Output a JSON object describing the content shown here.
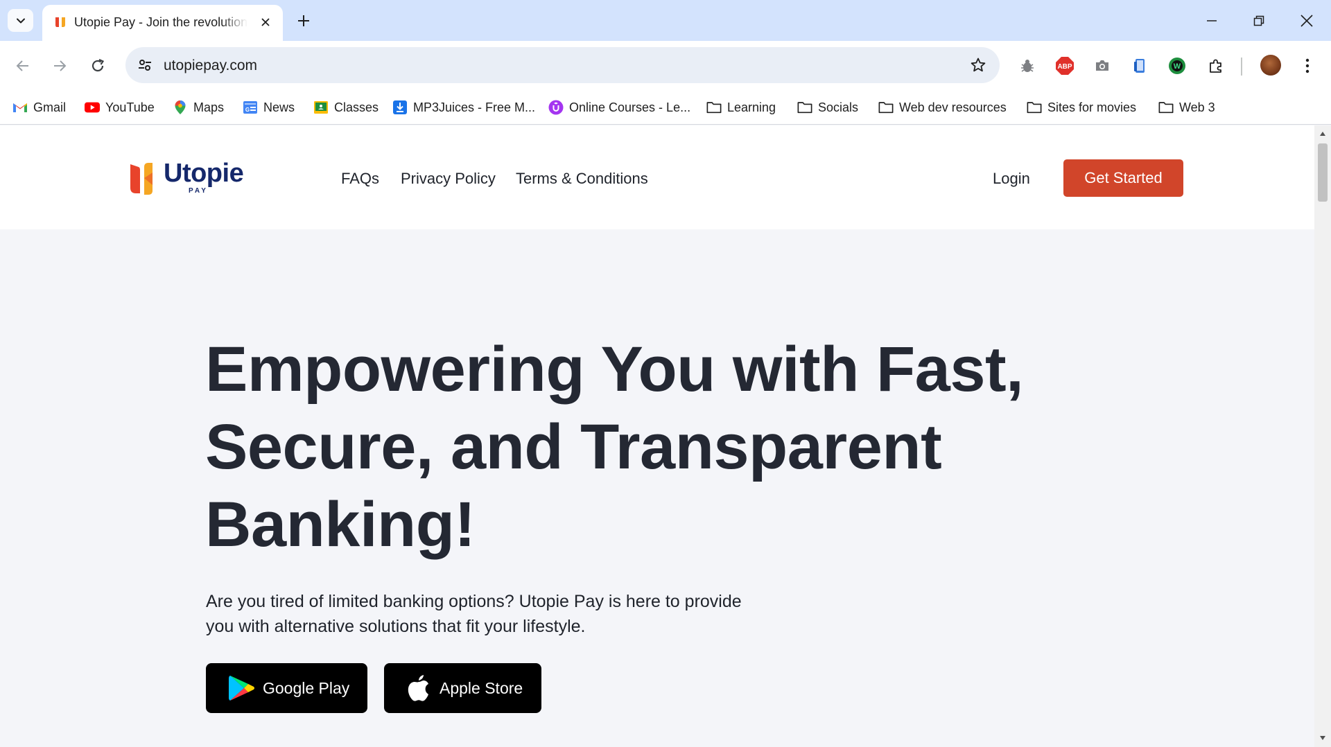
{
  "browser": {
    "tab": {
      "title": "Utopie Pay - Join the revolution"
    },
    "address_bar": {
      "url": "utopiepay.com"
    },
    "bookmarks": [
      {
        "label": "Gmail",
        "icon": "gmail-icon"
      },
      {
        "label": "YouTube",
        "icon": "youtube-icon"
      },
      {
        "label": "Maps",
        "icon": "maps-icon"
      },
      {
        "label": "News",
        "icon": "news-icon"
      },
      {
        "label": "Classes",
        "icon": "classes-icon"
      },
      {
        "label": "MP3Juices - Free M...",
        "icon": "download-icon"
      },
      {
        "label": "Online Courses - Le...",
        "icon": "udemy-icon"
      },
      {
        "label": "Learning",
        "icon": "folder-icon"
      },
      {
        "label": "Socials",
        "icon": "folder-icon"
      },
      {
        "label": "Web dev resources",
        "icon": "folder-icon"
      },
      {
        "label": "Sites for movies",
        "icon": "folder-icon"
      },
      {
        "label": "Web 3",
        "icon": "folder-icon"
      }
    ],
    "extensions": [
      "bug-icon",
      "adblock-icon",
      "camera-icon",
      "phone-icon",
      "wordtune-icon",
      "puzzle-icon"
    ]
  },
  "site": {
    "brand": {
      "name": "Utopie",
      "sub": "PAY"
    },
    "nav": [
      {
        "label": "FAQs"
      },
      {
        "label": "Privacy Policy"
      },
      {
        "label": "Terms & Conditions"
      }
    ],
    "login_label": "Login",
    "cta_label": "Get Started",
    "hero": {
      "title": "Empowering You with Fast, Secure, and Transparent Banking!",
      "subtitle": "Are you tired of limited banking options? Utopie Pay is here to provide you with alternative solutions that fit your lifestyle."
    },
    "stores": [
      {
        "label": "Google Play"
      },
      {
        "label": "Apple Store"
      }
    ]
  },
  "colors": {
    "accent": "#d1452a",
    "brand_navy": "#15286b",
    "chrome_tabstrip": "#d3e3fd",
    "page_bg": "#f4f5f9"
  }
}
